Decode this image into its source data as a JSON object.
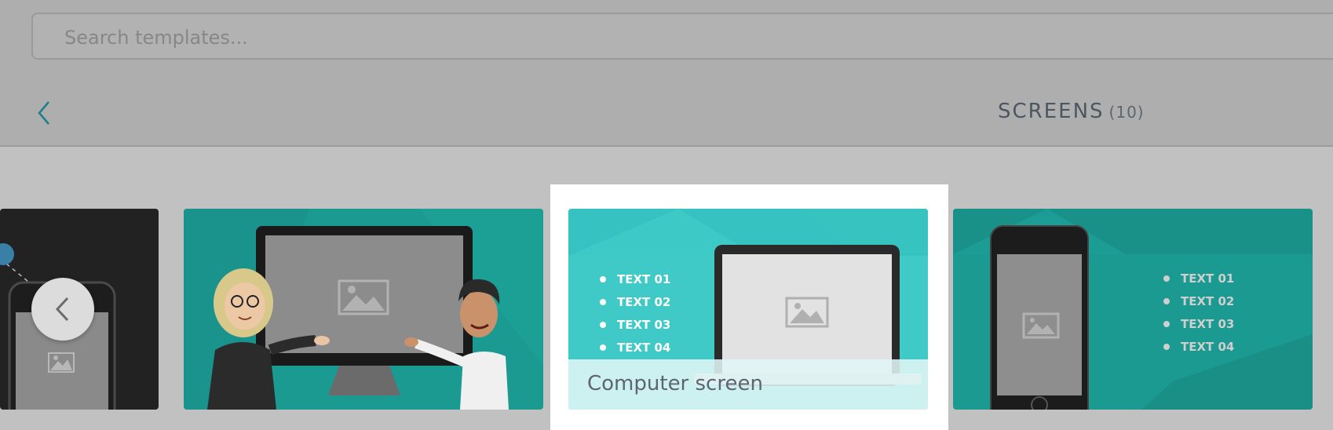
{
  "search": {
    "placeholder": "Search templates..."
  },
  "header": {
    "title": "SCREENS",
    "count": "(10)",
    "back_icon": "chevron-left-icon"
  },
  "colors": {
    "teal_dim": "#1b9a91",
    "teal_bright": "#3fcac8",
    "title_text": "#4d5660",
    "accent": "#1f7e8a"
  },
  "templates": [
    {
      "name": "Phone screen partial",
      "icon": "image-placeholder-icon"
    },
    {
      "name": "Monitor with presenters",
      "icon": "image-placeholder-icon"
    },
    {
      "name": "Computer screen",
      "caption": "Computer screen",
      "selected": true,
      "bullets": [
        "TEXT 01",
        "TEXT 02",
        "TEXT 03",
        "TEXT 04"
      ],
      "icon": "image-placeholder-icon"
    },
    {
      "name": "Phone with list",
      "bullets": [
        "TEXT 01",
        "TEXT 02",
        "TEXT 03",
        "TEXT 04"
      ],
      "icon": "image-placeholder-icon"
    }
  ],
  "carousel": {
    "prev_icon": "chevron-left-icon"
  }
}
